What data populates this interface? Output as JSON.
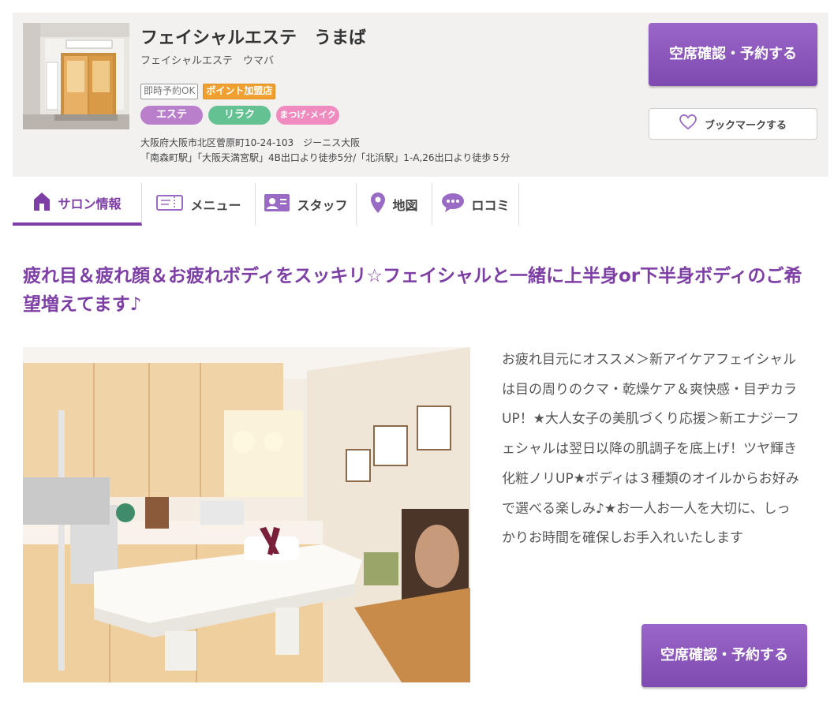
{
  "salon": {
    "name": "フェイシャルエステ　うまば",
    "kana": "フェイシャルエステ　ウマバ",
    "badges": [
      "即時予約OK",
      "ポイント加盟店"
    ],
    "categories": [
      "エステ",
      "リラク",
      "まつげ･メイク"
    ],
    "address": "大阪府大阪市北区菅原町10-24-103　ジーニス大阪",
    "access": "「南森町駅」「大阪天満宮駅」4B出口より徒歩5分/「北浜駅」1-A,26出口より徒歩５分"
  },
  "actions": {
    "reserve_label": "空席確認・予約する",
    "bookmark_label": "ブックマークする"
  },
  "tabs": [
    {
      "label": "サロン情報",
      "icon": "home-icon",
      "active": true
    },
    {
      "label": "メニュー",
      "icon": "ticket-icon"
    },
    {
      "label": "スタッフ",
      "icon": "staff-card-icon"
    },
    {
      "label": "地図",
      "icon": "map-pin-icon"
    },
    {
      "label": "ロコミ",
      "icon": "speech-bubble-icon"
    }
  ],
  "main": {
    "headline": "疲れ目＆疲れ顔＆お疲れボディをスッキリ☆フェイシャルと一緒に上半身or下半身ボディのご希望増えてます♪",
    "description": "お疲れ目元にオススメ＞新アイケアフェイシャルは目の周りのクマ・乾燥ケア＆爽快感・目ヂカラUP！★大人女子の美肌づくり応援＞新エナジーフェシャルは翌日以降の肌調子を底上げ！ツヤ輝き化粧ノリUP★ボディは３種類のオイルからお好みで選べる楽しみ♪★お一人お一人を大切に、しっかりお時間を確保しお手入れいたします"
  },
  "colors": {
    "brand_purple": "#7d3fa5",
    "button_purple": "#8e58be",
    "cat_este": "#b97fcb",
    "cat_relax": "#63c192",
    "cat_eyelash": "#f08bc0",
    "points_badge": "#f0a030"
  }
}
